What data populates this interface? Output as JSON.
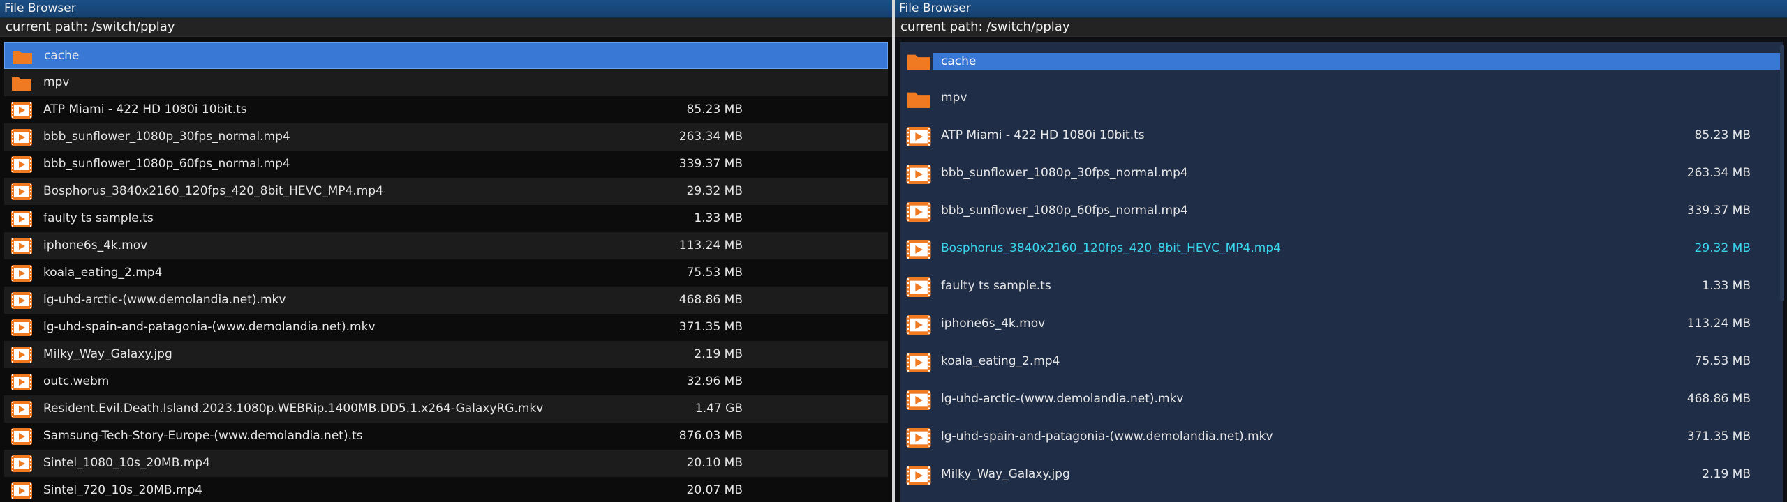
{
  "left": {
    "title": "File Browser",
    "path": "current path: /switch/pplay",
    "items": [
      {
        "name": "cache",
        "size": "",
        "type": "folder",
        "state": "selected"
      },
      {
        "name": "mpv",
        "size": "",
        "type": "folder",
        "state": "alt"
      },
      {
        "name": "ATP Miami - 422 HD 1080i 10bit.ts",
        "size": "85.23 MB",
        "type": "video",
        "state": ""
      },
      {
        "name": "bbb_sunflower_1080p_30fps_normal.mp4",
        "size": "263.34 MB",
        "type": "video",
        "state": "alt"
      },
      {
        "name": "bbb_sunflower_1080p_60fps_normal.mp4",
        "size": "339.37 MB",
        "type": "video",
        "state": ""
      },
      {
        "name": "Bosphorus_3840x2160_120fps_420_8bit_HEVC_MP4.mp4",
        "size": "29.32 MB",
        "type": "video",
        "state": "alt"
      },
      {
        "name": "faulty ts sample.ts",
        "size": "1.33 MB",
        "type": "video",
        "state": ""
      },
      {
        "name": "iphone6s_4k.mov",
        "size": "113.24 MB",
        "type": "video",
        "state": "alt"
      },
      {
        "name": "koala_eating_2.mp4",
        "size": "75.53 MB",
        "type": "video",
        "state": ""
      },
      {
        "name": "lg-uhd-arctic-(www.demolandia.net).mkv",
        "size": "468.86 MB",
        "type": "video",
        "state": "alt"
      },
      {
        "name": "lg-uhd-spain-and-patagonia-(www.demolandia.net).mkv",
        "size": "371.35 MB",
        "type": "video",
        "state": ""
      },
      {
        "name": "Milky_Way_Galaxy.jpg",
        "size": "2.19 MB",
        "type": "video",
        "state": "alt"
      },
      {
        "name": "outc.webm",
        "size": "32.96 MB",
        "type": "video",
        "state": ""
      },
      {
        "name": "Resident.Evil.Death.Island.2023.1080p.WEBRip.1400MB.DD5.1.x264-GalaxyRG.mkv",
        "size": "1.47 GB",
        "type": "video",
        "state": "alt"
      },
      {
        "name": "Samsung-Tech-Story-Europe-(www.demolandia.net).ts",
        "size": "876.03 MB",
        "type": "video",
        "state": ""
      },
      {
        "name": "Sintel_1080_10s_20MB.mp4",
        "size": "20.10 MB",
        "type": "video",
        "state": "alt"
      },
      {
        "name": "Sintel_720_10s_20MB.mp4",
        "size": "20.07 MB",
        "type": "video",
        "state": ""
      }
    ]
  },
  "right": {
    "title": "File Browser",
    "path": "current path: /switch/pplay",
    "items": [
      {
        "name": "cache",
        "size": "",
        "type": "folder",
        "state": "selected"
      },
      {
        "name": "mpv",
        "size": "",
        "type": "folder",
        "state": ""
      },
      {
        "name": "ATP Miami - 422 HD 1080i 10bit.ts",
        "size": "85.23 MB",
        "type": "video",
        "state": ""
      },
      {
        "name": "bbb_sunflower_1080p_30fps_normal.mp4",
        "size": "263.34 MB",
        "type": "video",
        "state": ""
      },
      {
        "name": "bbb_sunflower_1080p_60fps_normal.mp4",
        "size": "339.37 MB",
        "type": "video",
        "state": ""
      },
      {
        "name": "Bosphorus_3840x2160_120fps_420_8bit_HEVC_MP4.mp4",
        "size": "29.32 MB",
        "type": "video",
        "state": "highlight"
      },
      {
        "name": "faulty ts sample.ts",
        "size": "1.33 MB",
        "type": "video",
        "state": ""
      },
      {
        "name": "iphone6s_4k.mov",
        "size": "113.24 MB",
        "type": "video",
        "state": ""
      },
      {
        "name": "koala_eating_2.mp4",
        "size": "75.53 MB",
        "type": "video",
        "state": ""
      },
      {
        "name": "lg-uhd-arctic-(www.demolandia.net).mkv",
        "size": "468.86 MB",
        "type": "video",
        "state": ""
      },
      {
        "name": "lg-uhd-spain-and-patagonia-(www.demolandia.net).mkv",
        "size": "371.35 MB",
        "type": "video",
        "state": ""
      },
      {
        "name": "Milky_Way_Galaxy.jpg",
        "size": "2.19 MB",
        "type": "video",
        "state": ""
      }
    ]
  },
  "colors": {
    "folder": "#f07a22",
    "video": "#f07a22",
    "selection": "#3a78d6",
    "highlight_text": "#3ad6ef",
    "titlebar": "#1a4f86"
  },
  "icons": {
    "folder": "folder-icon",
    "video": "video-file-icon"
  }
}
